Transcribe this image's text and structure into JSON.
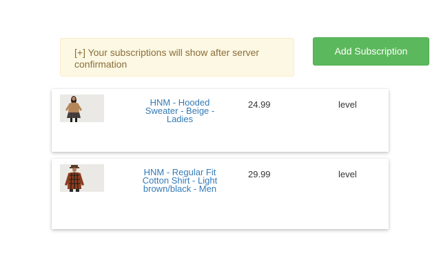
{
  "notice": {
    "text": "[+] Your subscriptions will show after server confirmation"
  },
  "toolbar": {
    "add_label": "Add Subscription"
  },
  "subscriptions": [
    {
      "name": "HNM - Hooded Sweater - Beige - Ladies",
      "price": "24.99",
      "level": "level",
      "image_icon": "product-photo-sweater-icon"
    },
    {
      "name": "HNM - Regular Fit Cotton Shirt - Light brown/black - Men",
      "price": "29.99",
      "level": "level",
      "image_icon": "product-photo-shirt-icon"
    }
  ],
  "colors": {
    "notice_bg": "#fcf8e3",
    "notice_text": "#8a6d3b",
    "button_bg": "#5cb85c",
    "link": "#337ab7"
  }
}
